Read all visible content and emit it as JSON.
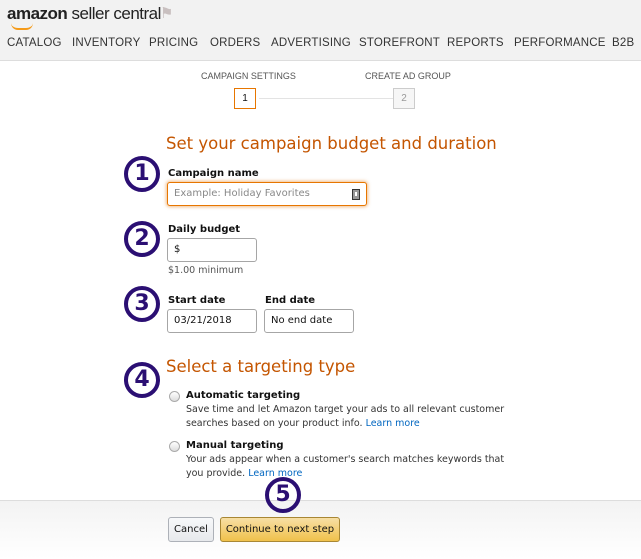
{
  "header": {
    "logo_brand": "amazon",
    "logo_product": "seller central",
    "flag_icon": "flag-icon"
  },
  "nav": {
    "items": [
      "CATALOG",
      "INVENTORY",
      "PRICING",
      "ORDERS",
      "ADVERTISING",
      "STOREFRONT",
      "REPORTS",
      "PERFORMANCE",
      "B2B"
    ]
  },
  "steps": [
    {
      "label": "CAMPAIGN SETTINGS",
      "number": "1",
      "active": true
    },
    {
      "label": "CREATE AD GROUP",
      "number": "2",
      "active": false
    }
  ],
  "section1": {
    "title": "Set your campaign budget and duration",
    "campaign_name": {
      "label": "Campaign name",
      "placeholder": "Example: Holiday Favorites",
      "value": ""
    },
    "daily_budget": {
      "label": "Daily budget",
      "value": "$",
      "hint": "$1.00 minimum"
    },
    "start_date": {
      "label": "Start date",
      "value": "03/21/2018"
    },
    "end_date": {
      "label": "End date",
      "value": "No end date"
    }
  },
  "section2": {
    "title": "Select a targeting type",
    "options": [
      {
        "title": "Automatic targeting",
        "desc": "Save time and let Amazon target your ads to all relevant customer searches based on your product info.",
        "link": "Learn more",
        "selected": false
      },
      {
        "title": "Manual targeting",
        "desc": "Your ads appear when a customer's search matches keywords that you provide.",
        "link": "Learn more",
        "selected": false
      }
    ]
  },
  "annotations": [
    "1",
    "2",
    "3",
    "4",
    "5"
  ],
  "footer": {
    "cancel": "Cancel",
    "continue": "Continue to next step"
  },
  "colors": {
    "accent": "#c45500",
    "annotation": "#2b0f73",
    "focus": "#e77600",
    "primary_button": "#f0c14b",
    "link": "#0066c0"
  }
}
